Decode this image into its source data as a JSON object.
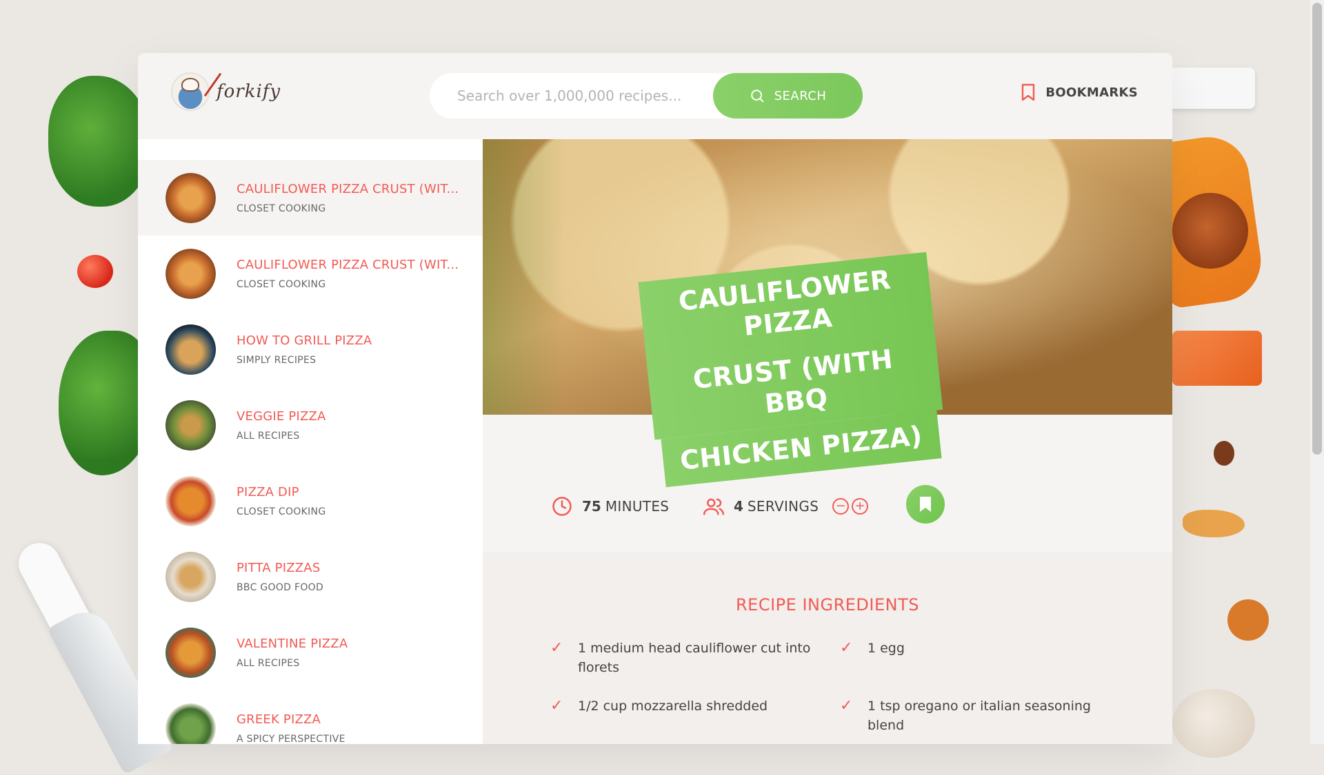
{
  "header": {
    "logo_text": "forkify",
    "search_placeholder": "Search over 1,000,000 recipes...",
    "search_button": "SEARCH",
    "bookmarks_label": "BOOKMARKS"
  },
  "results": [
    {
      "title": "CAULIFLOWER PIZZA CRUST (WIT...",
      "publisher": "CLOSET COOKING",
      "active": true
    },
    {
      "title": "CAULIFLOWER PIZZA CRUST (WIT...",
      "publisher": "CLOSET COOKING"
    },
    {
      "title": "HOW TO GRILL PIZZA",
      "publisher": "SIMPLY RECIPES"
    },
    {
      "title": "VEGGIE PIZZA",
      "publisher": "ALL RECIPES"
    },
    {
      "title": "PIZZA DIP",
      "publisher": "CLOSET COOKING"
    },
    {
      "title": "PITTA PIZZAS",
      "publisher": "BBC GOOD FOOD"
    },
    {
      "title": "VALENTINE PIZZA",
      "publisher": "ALL RECIPES"
    },
    {
      "title": "GREEK PIZZA",
      "publisher": "A SPICY PERSPECTIVE"
    }
  ],
  "recipe": {
    "title_lines": [
      "CAULIFLOWER PIZZA",
      "CRUST (WITH BBQ",
      "CHICKEN PIZZA)"
    ],
    "minutes": "75",
    "minutes_label": "MINUTES",
    "servings": "4",
    "servings_label": "SERVINGS",
    "ingredients_title": "RECIPE INGREDIENTS",
    "ingredients": [
      {
        "qty": "1",
        "desc": "medium head cauliflower cut into florets"
      },
      {
        "qty": "1",
        "desc": "egg"
      },
      {
        "qty": "1/2",
        "desc": "cup mozzarella shredded"
      },
      {
        "qty": "1",
        "desc": "tsp oregano or italian seasoning blend"
      }
    ]
  },
  "colors": {
    "accent_red": "#f25a54",
    "accent_green": "#7cc85b"
  },
  "icons": {
    "search": "search-icon",
    "bookmark": "bookmark-icon",
    "clock": "clock-icon",
    "users": "users-icon",
    "minus": "minus-circle-icon",
    "plus": "plus-circle-icon",
    "check": "check-icon"
  }
}
